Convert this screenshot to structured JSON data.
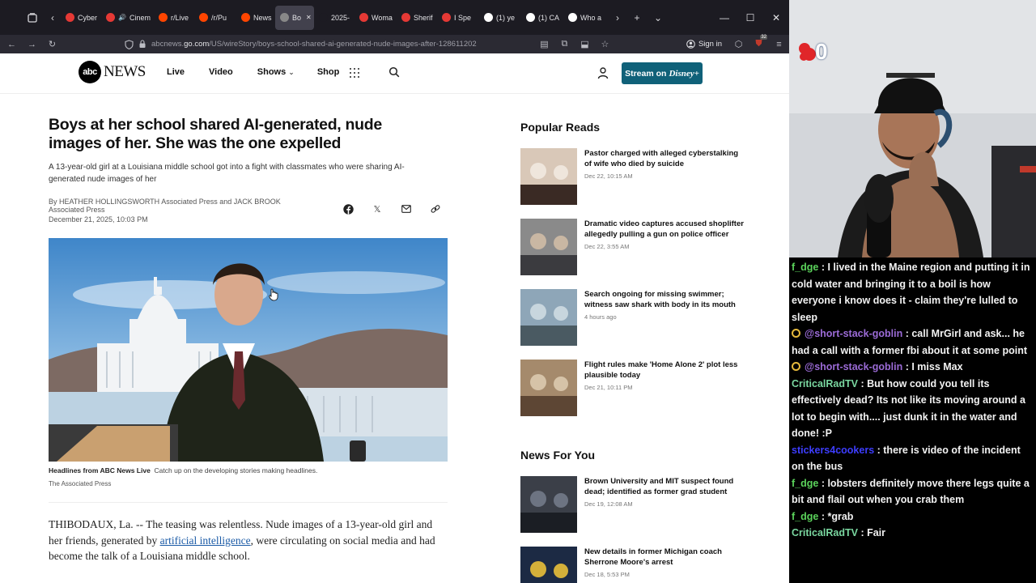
{
  "browser": {
    "tabs": [
      {
        "label": "Cyber",
        "color": "#e53935",
        "audio": false
      },
      {
        "label": "Cinem",
        "color": "#e53935",
        "audio": true
      },
      {
        "label": "r/Live",
        "color": "#ff4500",
        "audio": false
      },
      {
        "label": "/r/Pu",
        "color": "#ff4500",
        "audio": false
      },
      {
        "label": "News",
        "color": "#ff4500",
        "audio": false
      },
      {
        "label": "Bo",
        "color": "#888888",
        "audio": false,
        "active": true
      },
      {
        "label": "2025-",
        "color": "#1c1b22",
        "audio": false
      },
      {
        "label": "Woma",
        "color": "#e53935",
        "audio": false
      },
      {
        "label": "Sherif",
        "color": "#e53935",
        "audio": false
      },
      {
        "label": "I Spe",
        "color": "#e53935",
        "audio": false
      },
      {
        "label": "(1) ye",
        "color": "#ffffff",
        "audio": false
      },
      {
        "label": "(1) CA",
        "color": "#ffffff",
        "audio": false
      },
      {
        "label": "Who a",
        "color": "#ffffff",
        "audio": false
      }
    ],
    "url_prefix": "abcnews.",
    "url_domain": "go.com",
    "url_path": "/US/wireStory/boys-school-shared-ai-generated-nude-images-after-128611202",
    "sign_in": "Sign in",
    "ext_badge": "32"
  },
  "site": {
    "logo_abc": "abc",
    "logo_news": "NEWS",
    "menu": [
      "Live",
      "Video",
      "Shows",
      "Shop"
    ],
    "stream_label": "Stream on",
    "stream_brand": "Disney+"
  },
  "article": {
    "headline": "Boys at her school shared AI-generated, nude images of her. She was the one expelled",
    "dek": "A 13-year-old girl at a Louisiana middle school got into a fight with classmates who were sharing AI-generated nude images of her",
    "byline": "By HEATHER HOLLINGSWORTH Associated Press and JACK BROOK Associated Press",
    "date": "December 21, 2025, 10:03 PM",
    "caption_bold": "Headlines from ABC News Live",
    "caption_text": "Catch up on the developing stories making headlines.",
    "credit": "The Associated Press",
    "body_start": "THIBODAUX, La. -- The teasing was relentless. Nude images of a 13-year-old girl and her friends, generated by ",
    "body_link": "artificial intelligence",
    "body_end": ", were circulating on social media and had become the talk of a Louisiana middle school."
  },
  "popular": {
    "title": "Popular Reads",
    "items": [
      {
        "title": "Pastor charged with alleged cyberstalking of wife who died by suicide",
        "time": "Dec 22, 10:15 AM"
      },
      {
        "title": "Dramatic video captures accused shoplifter allegedly pulling a gun on police officer",
        "time": "Dec 22, 3:55 AM"
      },
      {
        "title": "Search ongoing for missing swimmer; witness saw shark with body in its mouth",
        "time": "4 hours ago"
      },
      {
        "title": "Flight rules make 'Home Alone 2' plot less plausible today",
        "time": "Dec 21, 10:11 PM"
      }
    ]
  },
  "for_you": {
    "title": "News For You",
    "items": [
      {
        "title": "Brown University and MIT suspect found dead; identified as former grad student",
        "time": "Dec 19, 12:08 AM"
      },
      {
        "title": "New details in former Michigan coach Sherrone Moore's arrest",
        "time": "Dec 18, 5:53 PM"
      }
    ]
  },
  "stream": {
    "counter": "0",
    "chat": [
      {
        "user": "f_dge",
        "color": "#5bd35b",
        "text": "I lived in the Maine region and putting it in cold water and bringing it to a boil is how everyone i know does it - claim they're lulled to sleep",
        "badge": false
      },
      {
        "user": "@short-stack-goblin",
        "color": "#9b6bd6",
        "text": "call MrGirl and ask... he had a call with a former fbi about it at some point",
        "badge": true
      },
      {
        "user": "@short-stack-goblin",
        "color": "#9b6bd6",
        "text": "I miss Max",
        "badge": true
      },
      {
        "user": "CriticalRadTV",
        "color": "#7ad7a0",
        "text": "But how could you tell its effectively dead? Its not like its moving around a lot to begin with.... just dunk it in the water and done! :P",
        "badge": false
      },
      {
        "user": "stickers4cookers",
        "color": "#3d3dff",
        "text": "there is video of the incident on the bus",
        "badge": false
      },
      {
        "user": "f_dge",
        "color": "#5bd35b",
        "text": "lobsters definitely move there legs quite a bit and flail out when you crab them",
        "badge": false
      },
      {
        "user": "f_dge",
        "color": "#5bd35b",
        "text": "*grab",
        "badge": false
      },
      {
        "user": "CriticalRadTV",
        "color": "#7ad7a0",
        "text": "Fair",
        "badge": false
      }
    ]
  }
}
